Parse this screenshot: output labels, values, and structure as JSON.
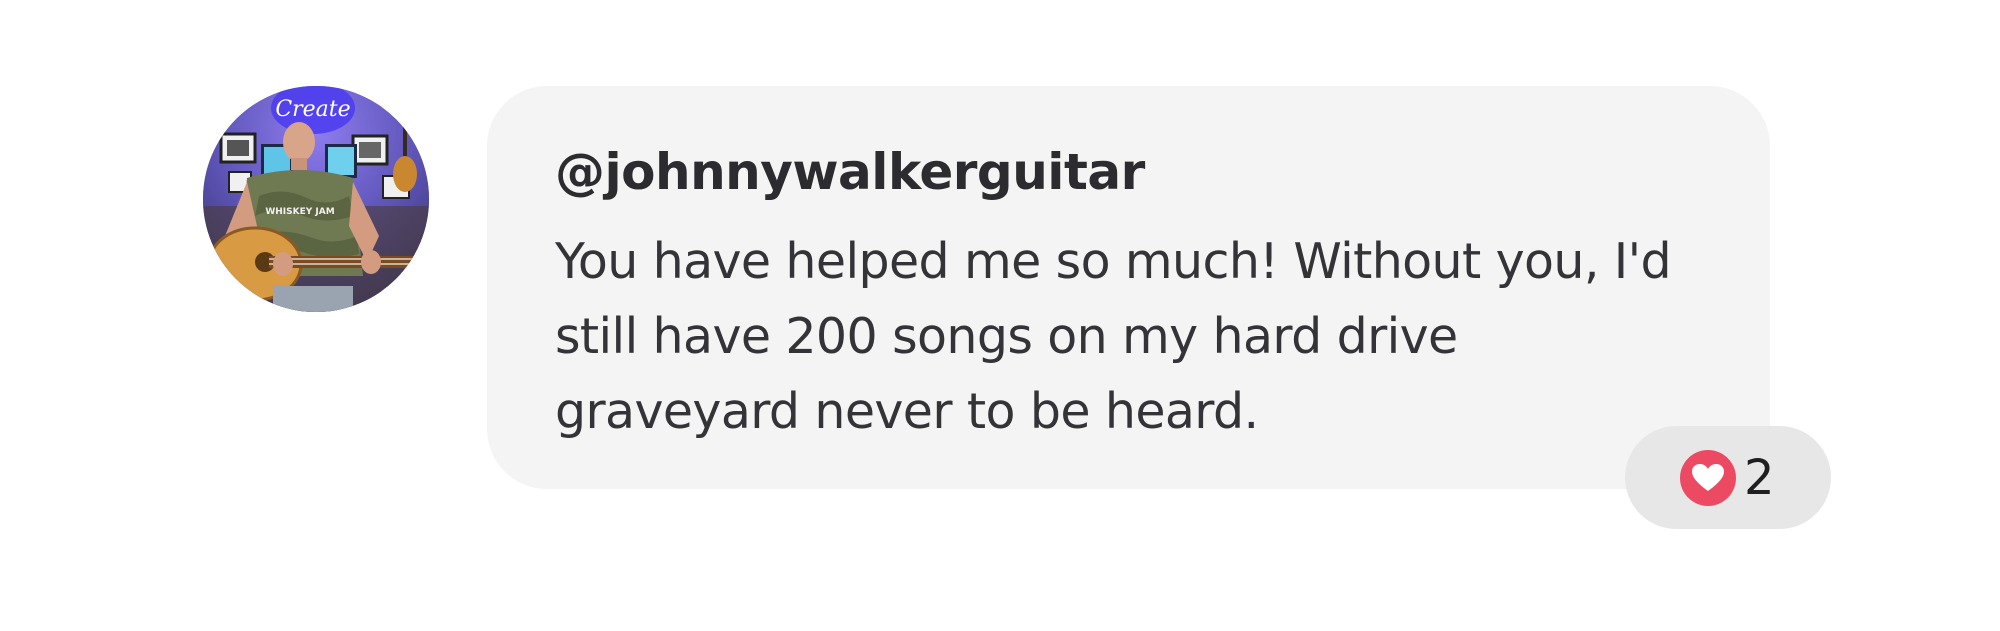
{
  "comment": {
    "username": "@johnnywalkerguitar",
    "text": "You have helped me so much! Without you, I'd still have 200 songs on my hard drive graveyard never to be heard.",
    "avatar": {
      "alt": "johnnywalkerguitar avatar",
      "neon_sign": "Create",
      "shirt_text": "WHISKEY JAM"
    },
    "reactions": {
      "icon": "heart-icon",
      "count": "2",
      "color": "#ec4a62"
    }
  },
  "colors": {
    "bubble_bg": "#f4f4f4",
    "reaction_bg": "#e7e7e7",
    "text": "#333338"
  }
}
